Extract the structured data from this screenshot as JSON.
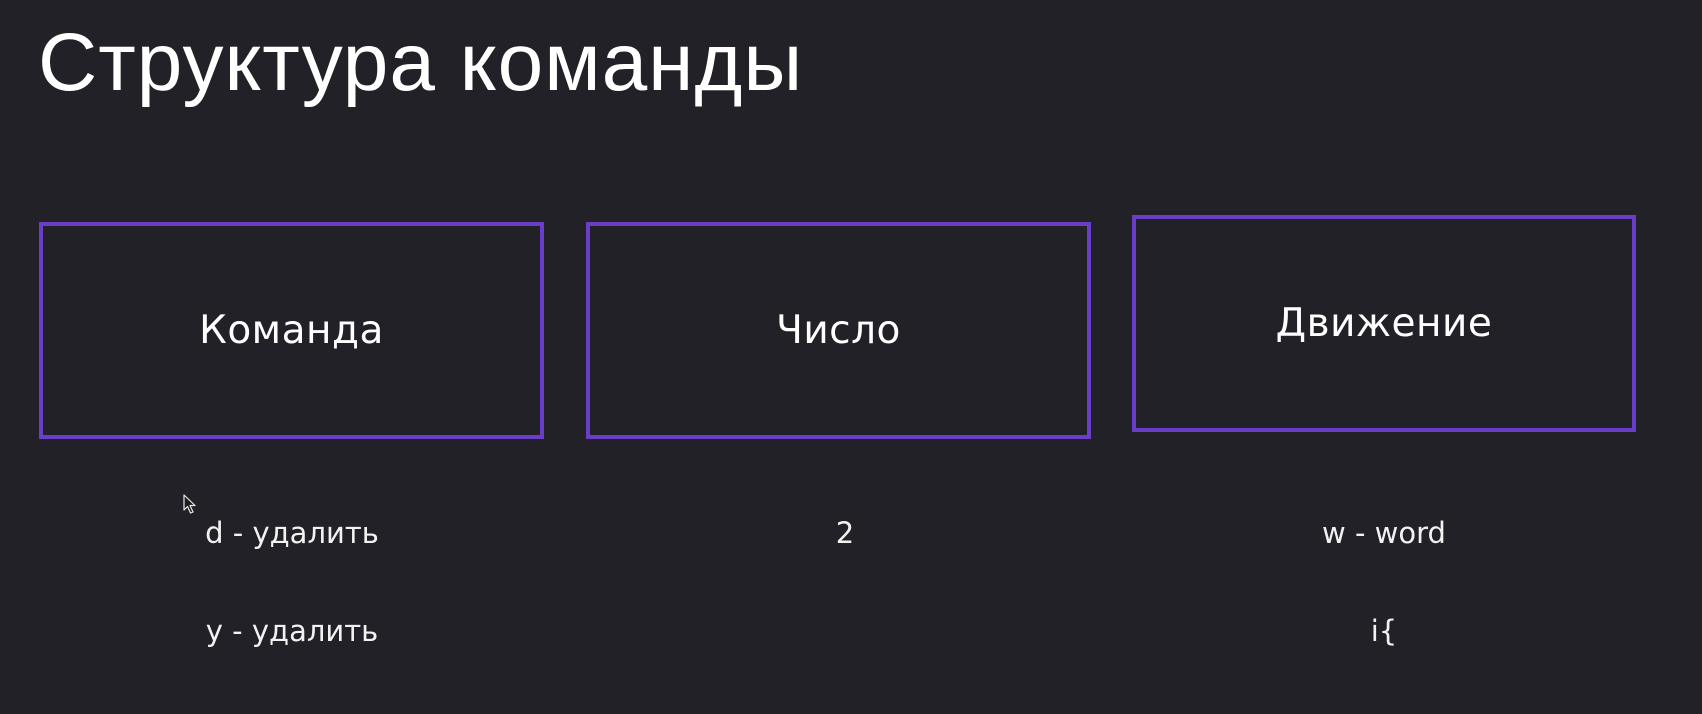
{
  "slide": {
    "title": "Структура команды"
  },
  "boxes": {
    "command": "Команда",
    "number": "Число",
    "motion": "Движение"
  },
  "examples": {
    "command": [
      "d - удалить",
      "y - удалить"
    ],
    "number": [
      "2"
    ],
    "motion": [
      "w - word",
      "i{"
    ]
  },
  "colors": {
    "background": "#222127",
    "box_border": "#6a3ec9",
    "text": "#ffffff"
  }
}
